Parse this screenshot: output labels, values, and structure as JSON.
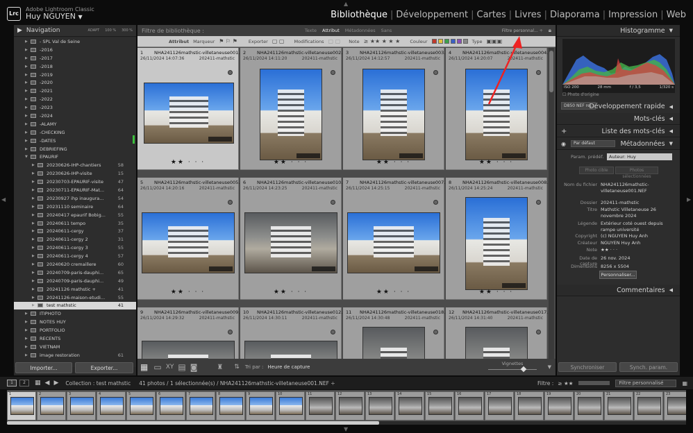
{
  "app": {
    "name": "Adobe Lightroom Classic",
    "user": "Huy NGUYEN",
    "logo": "Lrc"
  },
  "modules": [
    "Bibliothèque",
    "Développement",
    "Cartes",
    "Livres",
    "Diaporama",
    "Impression",
    "Web"
  ],
  "active_module": "Bibliothèque",
  "navigator": {
    "title": "Navigation",
    "opts": [
      "ADAPT",
      "100 %",
      "300 %"
    ]
  },
  "folders": [
    {
      "label": "- SPL Val de Seine",
      "count": ""
    },
    {
      "label": "-2016",
      "count": ""
    },
    {
      "label": "-2017",
      "count": ""
    },
    {
      "label": "-2018",
      "count": ""
    },
    {
      "label": "-2019",
      "count": ""
    },
    {
      "label": "-2020",
      "count": ""
    },
    {
      "label": "-2021",
      "count": ""
    },
    {
      "label": "-2022",
      "count": ""
    },
    {
      "label": "-2023",
      "count": ""
    },
    {
      "label": "-2024",
      "count": ""
    },
    {
      "label": "-ALAMY",
      "count": ""
    },
    {
      "label": "-CHECKING",
      "count": ""
    },
    {
      "label": "-DATES",
      "count": ""
    },
    {
      "label": "DEBRIEFING",
      "count": ""
    },
    {
      "label": "EPAURIF",
      "count": ""
    },
    {
      "label": "20230626-IHP-chantiers",
      "count": "58"
    },
    {
      "label": "20230626-IHP-visite",
      "count": "15"
    },
    {
      "label": "20230703-EPAURIF-visite",
      "count": "47"
    },
    {
      "label": "20230711-EPAURIF-Mat...",
      "count": "64"
    },
    {
      "label": "20230927 ihp inaugura...",
      "count": "54"
    },
    {
      "label": "20231110 seminaire",
      "count": "64"
    },
    {
      "label": "20240417 epaurif Bobig...",
      "count": "55"
    },
    {
      "label": "20240611 tempo",
      "count": "35"
    },
    {
      "label": "20240611-cergy",
      "count": "37"
    },
    {
      "label": "20240611-cergy 2",
      "count": "31"
    },
    {
      "label": "20240611-cergy 3",
      "count": "55"
    },
    {
      "label": "20240611-cergy 4",
      "count": "57"
    },
    {
      "label": "20240620 cremaillere",
      "count": "60"
    },
    {
      "label": "20240709-paris-dauphi...",
      "count": "65"
    },
    {
      "label": "20240709-paris-dauphi...",
      "count": "49"
    },
    {
      "label": "20241126 mathstic +",
      "count": "41"
    },
    {
      "label": "20241126-maison-etudi...",
      "count": "55"
    },
    {
      "label": "test mathstic",
      "count": "41"
    },
    {
      "label": "ITIPHOTO",
      "count": ""
    },
    {
      "label": "NOTES HUY",
      "count": ""
    },
    {
      "label": "PORTFOLIO",
      "count": ""
    },
    {
      "label": "RECENTS",
      "count": ""
    },
    {
      "label": "VIETNAM",
      "count": ""
    },
    {
      "label": "image restoration",
      "count": "61"
    }
  ],
  "left_buttons": {
    "import": "Importer...",
    "export": "Exporter..."
  },
  "filter": {
    "title": "Filtre de bibliothèque :",
    "tabs": [
      "Texte",
      "Attribut",
      "Métadonnées",
      "Sans"
    ],
    "active": "Attribut",
    "preset": "Filtre personnal... ÷"
  },
  "attr": {
    "label": "Attribut",
    "marker": "Marqueur",
    "export": "Exporter",
    "mods": "Modifications",
    "note": "Note",
    "color": "Couleur",
    "type": "Type",
    "colors": [
      "#c0392b",
      "#e2c13a",
      "#3ca04a",
      "#3a5fc4",
      "#8a4fb8",
      "#888888"
    ]
  },
  "cells": [
    {
      "n": "1",
      "file": "NHA241126mathstic-villetaneuse001.NEF",
      "date": "26/11/2024 14:07:36",
      "folder": "202411-mathstic",
      "stars": "★★ · · ·",
      "sel": true
    },
    {
      "n": "2",
      "file": "NHA241126mathstic-villetaneuse002.NEF",
      "date": "26/11/2024 14:11:20",
      "folder": "202411-mathstic",
      "stars": "★★ · · ·"
    },
    {
      "n": "3",
      "file": "NHA241126mathstic-villetaneuse003.NEF",
      "date": "26/11/2024 14:12:57",
      "folder": "202411-mathstic",
      "stars": "★★ · · ·"
    },
    {
      "n": "4",
      "file": "NHA241126mathstic-villetaneuse004.NEF",
      "date": "26/11/2024 14:20:07",
      "folder": "202411-mathstic",
      "stars": "★★ · · ·"
    },
    {
      "n": "5",
      "file": "NHA241126mathstic-villetaneuse005.NEF",
      "date": "26/11/2024 14:20:16",
      "folder": "202411-mathstic",
      "stars": "★★ · · ·"
    },
    {
      "n": "6",
      "file": "NHA241126mathstic-villetaneuse010.NEF",
      "date": "26/11/2024 14:23:25",
      "folder": "202411-mathstic",
      "stars": "★★ · · ·"
    },
    {
      "n": "7",
      "file": "NHA241126mathstic-villetaneuse007.NEF",
      "date": "26/11/2024 14:25:15",
      "folder": "202411-mathstic",
      "stars": "★★ · · ·"
    },
    {
      "n": "8",
      "file": "NHA241126mathstic-villetaneuse008.NEF",
      "date": "26/11/2024 14:25:24",
      "folder": "202411-mathstic",
      "stars": "★★ · · ·"
    },
    {
      "n": "9",
      "file": "NHA241126mathstic-villetaneuse009.NEF",
      "date": "26/11/2024 14:29:32",
      "folder": "202411-mathstic",
      "stars": ""
    },
    {
      "n": "10",
      "file": "NHA241126mathstic-villetaneuse012.NEF",
      "date": "26/11/2024 14:30:11",
      "folder": "202411-mathstic",
      "stars": ""
    },
    {
      "n": "11",
      "file": "NHA241126mathstic-villetaneuse018.NEF",
      "date": "26/11/2024 14:30:48",
      "folder": "202411-mathstic",
      "stars": ""
    },
    {
      "n": "12",
      "file": "NHA241126mathstic-villetaneuse017.NEF",
      "date": "26/11/2024 14:31:40",
      "folder": "202411-mathstic",
      "stars": ""
    }
  ],
  "toolbar": {
    "sort_label": "Tri par :",
    "sort_value": "Heure de capture",
    "thumbs": "Vignettes"
  },
  "right": {
    "histogram": "Histogramme",
    "histo_info": [
      "ISO 200",
      "28 mm",
      "f / 3,5",
      "1/320 s"
    ],
    "original": "Photo d'origine",
    "dev_preset": "D850 NEF re...",
    "quick_dev": "Développement rapide",
    "keywords": "Mots-clés",
    "keyword_list": "Liste des mots-clés",
    "metadata": "Métadonnées",
    "default": "Par défaut",
    "preset_label": "Param. prédéf.",
    "preset_value": "Auteur: Huy",
    "photo_cible": "Photo cible",
    "photos_sel": "Photos sélectionnées",
    "fields": [
      {
        "k": "Nom du fichier",
        "v": "NHA241126mathstic-villetaneuse001.NEF"
      },
      {
        "k": "Dossier",
        "v": "202411-mathstic"
      },
      {
        "k": "Titre",
        "v": "Mathstic Villetaneuse 26 novembre 2024"
      },
      {
        "k": "Légende",
        "v": "Extérieur coté ouest depuis rampe université"
      },
      {
        "k": "Copyright",
        "v": "(c) NGUYEN Huy Anh"
      },
      {
        "k": "Créateur",
        "v": "NGUYEN Huy Anh"
      },
      {
        "k": "Note",
        "v": "★★ · · ·"
      },
      {
        "k": "Date de capture",
        "v": "26 nov. 2024"
      },
      {
        "k": "Dimensions",
        "v": "8256 x 5504"
      }
    ],
    "customize": "Personnaliser...",
    "comments": "Commentaires",
    "sync": "Synchroniser",
    "sync_params": "Synch. param."
  },
  "bottom": {
    "p1": "1",
    "p2": "2",
    "collection": "Collection : test mathstic",
    "count": "41 photos / 1 sélectionnée(s) / NHA241126mathstic-villetaneuse001.NEF ÷",
    "filtre": "Filtre :",
    "filtre_value": "Filtre personnalisé"
  },
  "film_count": 23
}
